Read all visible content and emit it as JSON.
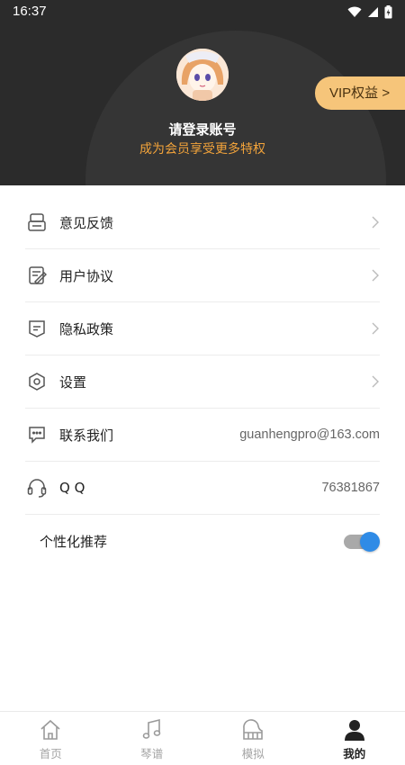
{
  "status_bar": {
    "time": "16:37"
  },
  "header": {
    "login_title": "请登录账号",
    "login_subtitle": "成为会员享受更多特权",
    "vip_button": "VIP权益 >"
  },
  "menu": {
    "feedback": "意见反馈",
    "user_agreement": "用户协议",
    "privacy_policy": "隐私政策",
    "settings": "设置",
    "contact_us": "联系我们",
    "contact_email": "guanhengpro@163.com",
    "qq_label": "Q Q",
    "qq_number": "76381867",
    "personalized": "个性化推荐",
    "personalized_enabled": true
  },
  "bottom_nav": {
    "home": "首页",
    "scores": "琴谱",
    "simulate": "模拟",
    "mine": "我的",
    "active": "mine"
  },
  "colors": {
    "header_bg": "#2b2b2b",
    "accent_orange": "#f2a33a",
    "vip_bg": "#f6c57a",
    "toggle_blue": "#2f8be6"
  }
}
